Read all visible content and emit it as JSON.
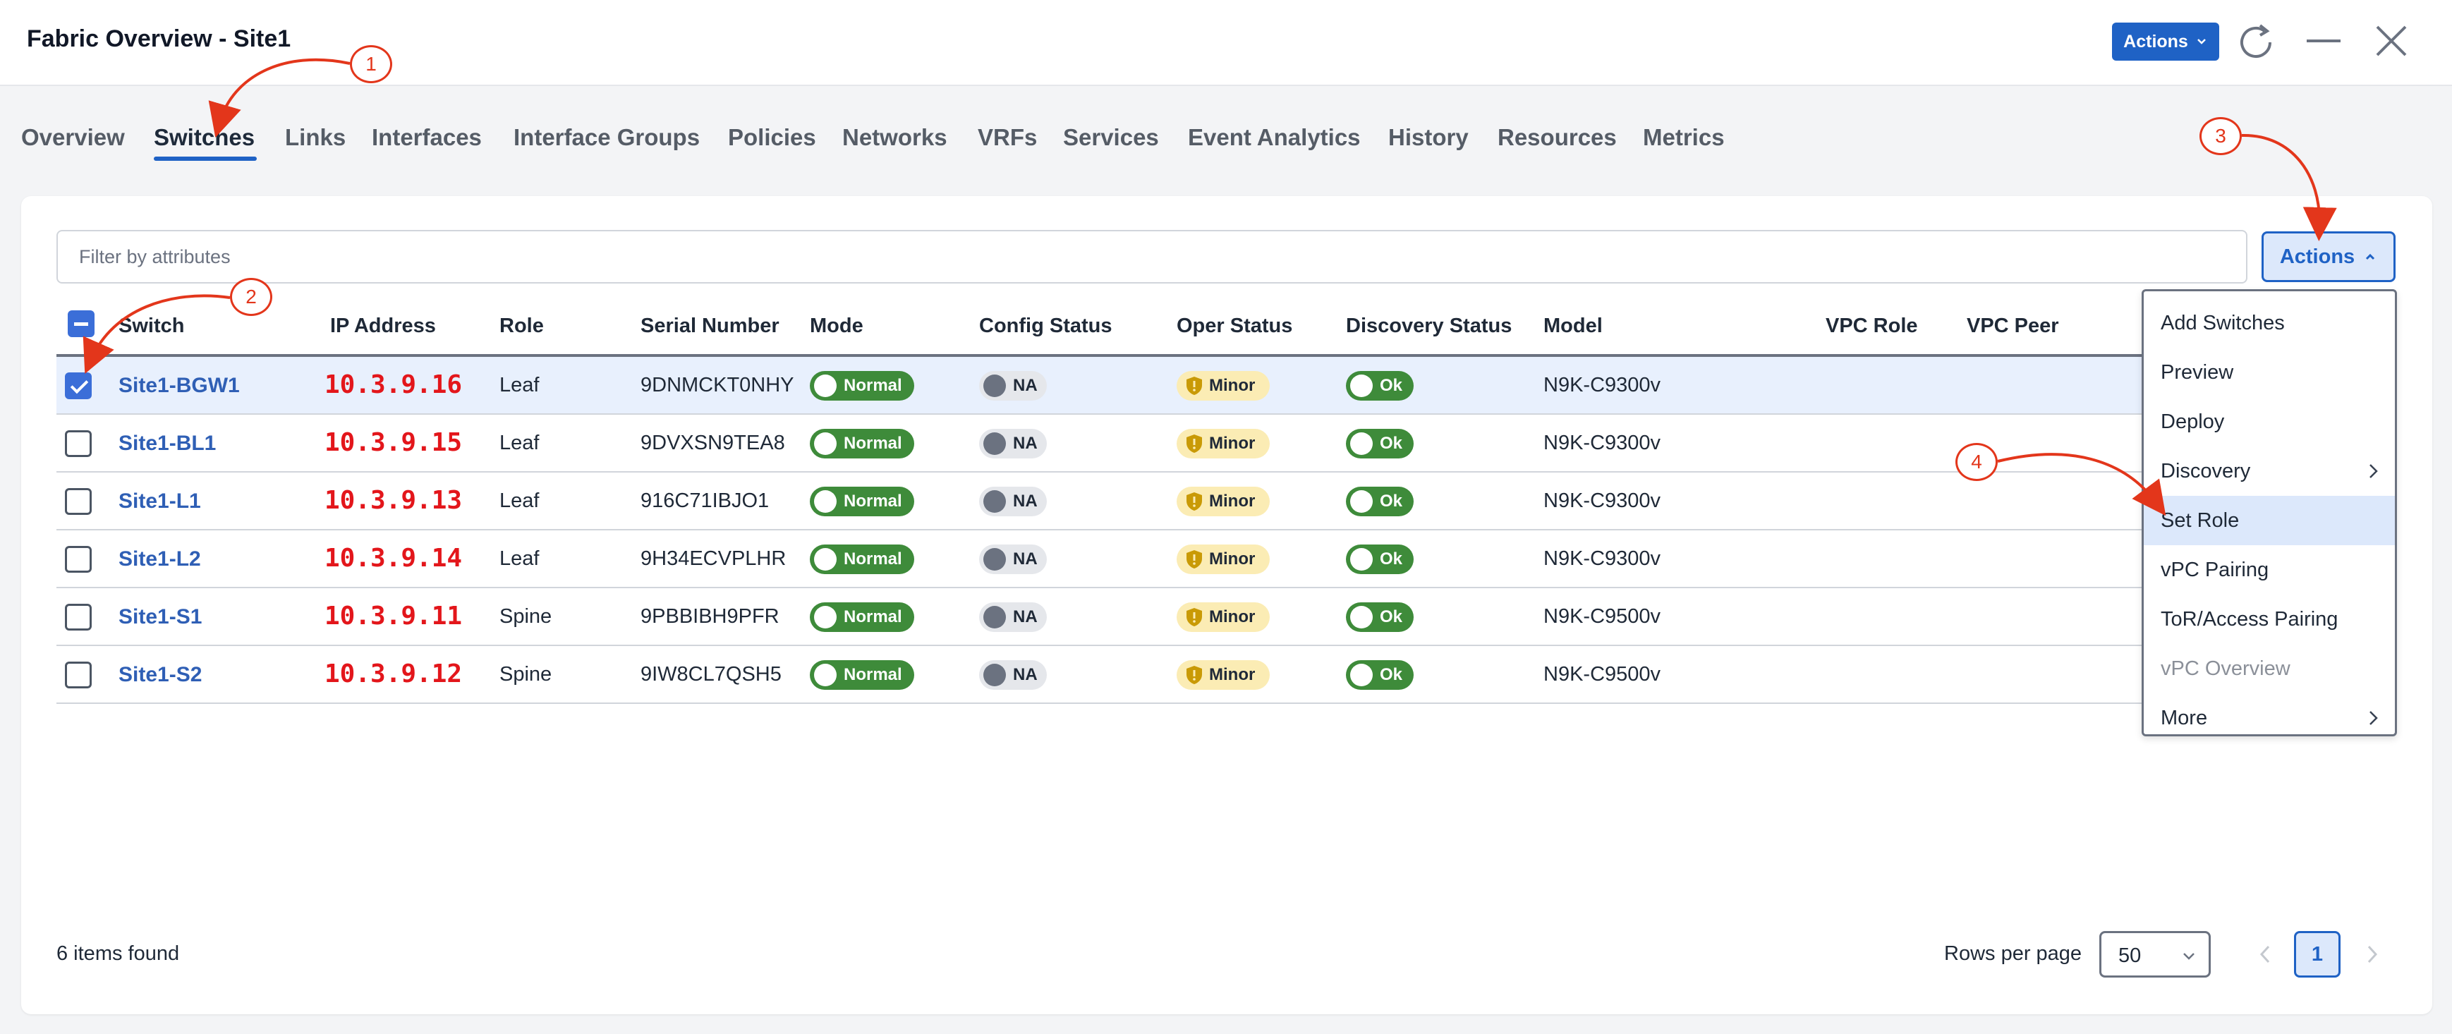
{
  "window": {
    "title": "Fabric Overview - Site1",
    "actions_label": "Actions"
  },
  "tabs": [
    {
      "label": "Overview"
    },
    {
      "label": "Switches",
      "active": true
    },
    {
      "label": "Links"
    },
    {
      "label": "Interfaces"
    },
    {
      "label": "Interface Groups"
    },
    {
      "label": "Policies"
    },
    {
      "label": "Networks"
    },
    {
      "label": "VRFs"
    },
    {
      "label": "Services"
    },
    {
      "label": "Event Analytics"
    },
    {
      "label": "History"
    },
    {
      "label": "Resources"
    },
    {
      "label": "Metrics"
    }
  ],
  "filter": {
    "placeholder": "Filter by attributes"
  },
  "card_actions_label": "Actions",
  "table": {
    "columns": [
      "Switch",
      "IP Address",
      "Role",
      "Serial Number",
      "Mode",
      "Config Status",
      "Oper Status",
      "Discovery Status",
      "Model",
      "VPC Role",
      "VPC Peer"
    ],
    "rows": [
      {
        "switch": "Site1-BGW1",
        "ip": "10.3.9.16",
        "role": "Leaf",
        "serial": "9DNMCKT0NHY",
        "mode": "Normal",
        "config": "NA",
        "oper": "Minor",
        "discovery": "Ok",
        "model": "N9K-C9300v",
        "checked": true
      },
      {
        "switch": "Site1-BL1",
        "ip": "10.3.9.15",
        "role": "Leaf",
        "serial": "9DVXSN9TEA8",
        "mode": "Normal",
        "config": "NA",
        "oper": "Minor",
        "discovery": "Ok",
        "model": "N9K-C9300v",
        "checked": false
      },
      {
        "switch": "Site1-L1",
        "ip": "10.3.9.13",
        "role": "Leaf",
        "serial": "916C71IBJO1",
        "mode": "Normal",
        "config": "NA",
        "oper": "Minor",
        "discovery": "Ok",
        "model": "N9K-C9300v",
        "checked": false
      },
      {
        "switch": "Site1-L2",
        "ip": "10.3.9.14",
        "role": "Leaf",
        "serial": "9H34ECVPLHR",
        "mode": "Normal",
        "config": "NA",
        "oper": "Minor",
        "discovery": "Ok",
        "model": "N9K-C9300v",
        "checked": false
      },
      {
        "switch": "Site1-S1",
        "ip": "10.3.9.11",
        "role": "Spine",
        "serial": "9PBBIBH9PFR",
        "mode": "Normal",
        "config": "NA",
        "oper": "Minor",
        "discovery": "Ok",
        "model": "N9K-C9500v",
        "checked": false
      },
      {
        "switch": "Site1-S2",
        "ip": "10.3.9.12",
        "role": "Spine",
        "serial": "9IW8CL7QSH5",
        "mode": "Normal",
        "config": "NA",
        "oper": "Minor",
        "discovery": "Ok",
        "model": "N9K-C9500v",
        "checked": false
      }
    ]
  },
  "menu": {
    "items": [
      {
        "label": "Add Switches"
      },
      {
        "label": "Preview"
      },
      {
        "label": "Deploy"
      },
      {
        "label": "Discovery",
        "submenu": true
      },
      {
        "label": "Set Role",
        "highlighted": true
      },
      {
        "label": "vPC Pairing"
      },
      {
        "label": "ToR/Access Pairing"
      },
      {
        "label": "vPC Overview",
        "disabled": true
      },
      {
        "label": "More",
        "submenu": true
      }
    ]
  },
  "footer": {
    "items_found": "6 items found",
    "rows_per_page_label": "Rows per page",
    "rows_per_page_value": "50",
    "current_page": "1"
  },
  "annotations": [
    "1",
    "2",
    "3",
    "4"
  ],
  "colors": {
    "accent": "#1f62c5",
    "ip_text": "#e3161b",
    "annotation": "#e3361b",
    "ok_green": "#3e8b3a",
    "minor_yellow": "#fbecb4"
  }
}
